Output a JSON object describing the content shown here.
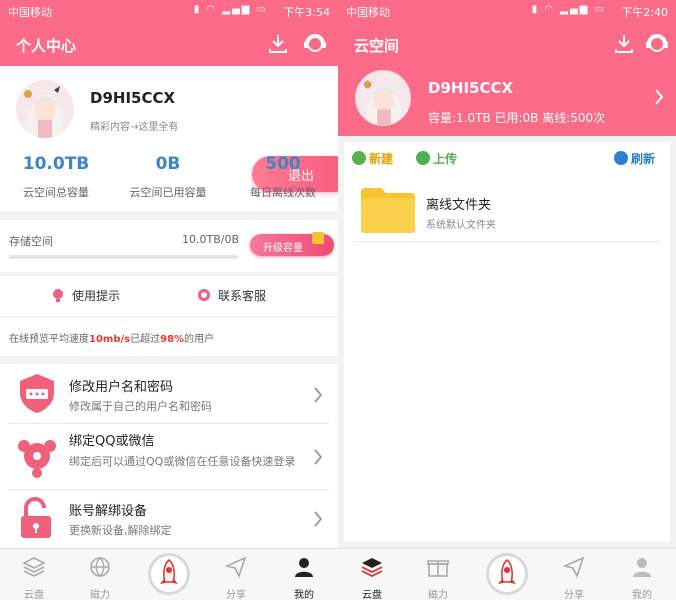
{
  "left": {
    "status": {
      "carrier": "中国移动",
      "time": "下午3:54"
    },
    "appbar": {
      "title": "个人中心"
    },
    "profile": {
      "username": "D9HI5CCX",
      "slogan": "精彩内容→这里全有",
      "logout_label": "退出"
    },
    "stats": [
      {
        "value": "10.0TB",
        "caption": "云空间总容量"
      },
      {
        "value": "0B",
        "caption": "云空间已用容量"
      },
      {
        "value": "500",
        "caption": "每日离线次数"
      }
    ],
    "storage": {
      "label": "存储空间",
      "value": "10.0TB/0B",
      "used_fraction": 0.0,
      "upgrade_label": "升级容量"
    },
    "tips": {
      "usage_tip": "使用提示",
      "contact": "联系客服"
    },
    "speed": {
      "prefix": "在线预览平均速度",
      "speed": "10mb/s",
      "middle": "已超过",
      "percent": "98%",
      "suffix": "的用户"
    },
    "menu": [
      {
        "title": "修改用户名和密码",
        "subtitle": "修改属于自己的用户名和密码"
      },
      {
        "title": "绑定QQ或微信",
        "subtitle": "绑定后可以通过QQ或微信在任意设备快速登录"
      },
      {
        "title": "账号解绑设备",
        "subtitle": "更换新设备,解除绑定"
      }
    ],
    "tabs": [
      {
        "label": "云盘"
      },
      {
        "label": "磁力"
      },
      {
        "label": "分享"
      },
      {
        "label": "我的"
      }
    ]
  },
  "right": {
    "status": {
      "carrier": "中国移动",
      "time": "下午2:40"
    },
    "appbar": {
      "title": "云空间"
    },
    "profile": {
      "username": "D9HI5CCX",
      "quota": "容量:1.0TB 已用:0B 离线:500次"
    },
    "toolbar": {
      "new": "新建",
      "upload": "上传",
      "refresh": "刷新"
    },
    "folder": {
      "name": "离线文件夹",
      "desc": "系统默认文件夹"
    },
    "tabs": [
      {
        "label": "云盘"
      },
      {
        "label": "磁力"
      },
      {
        "label": "分享"
      },
      {
        "label": "我的"
      }
    ]
  },
  "colors": {
    "brand_pink": "#fb6b88",
    "stat_blue": "#3a86c8",
    "highlight_red": "#e53935",
    "folder_yellow": "#f8c530"
  }
}
